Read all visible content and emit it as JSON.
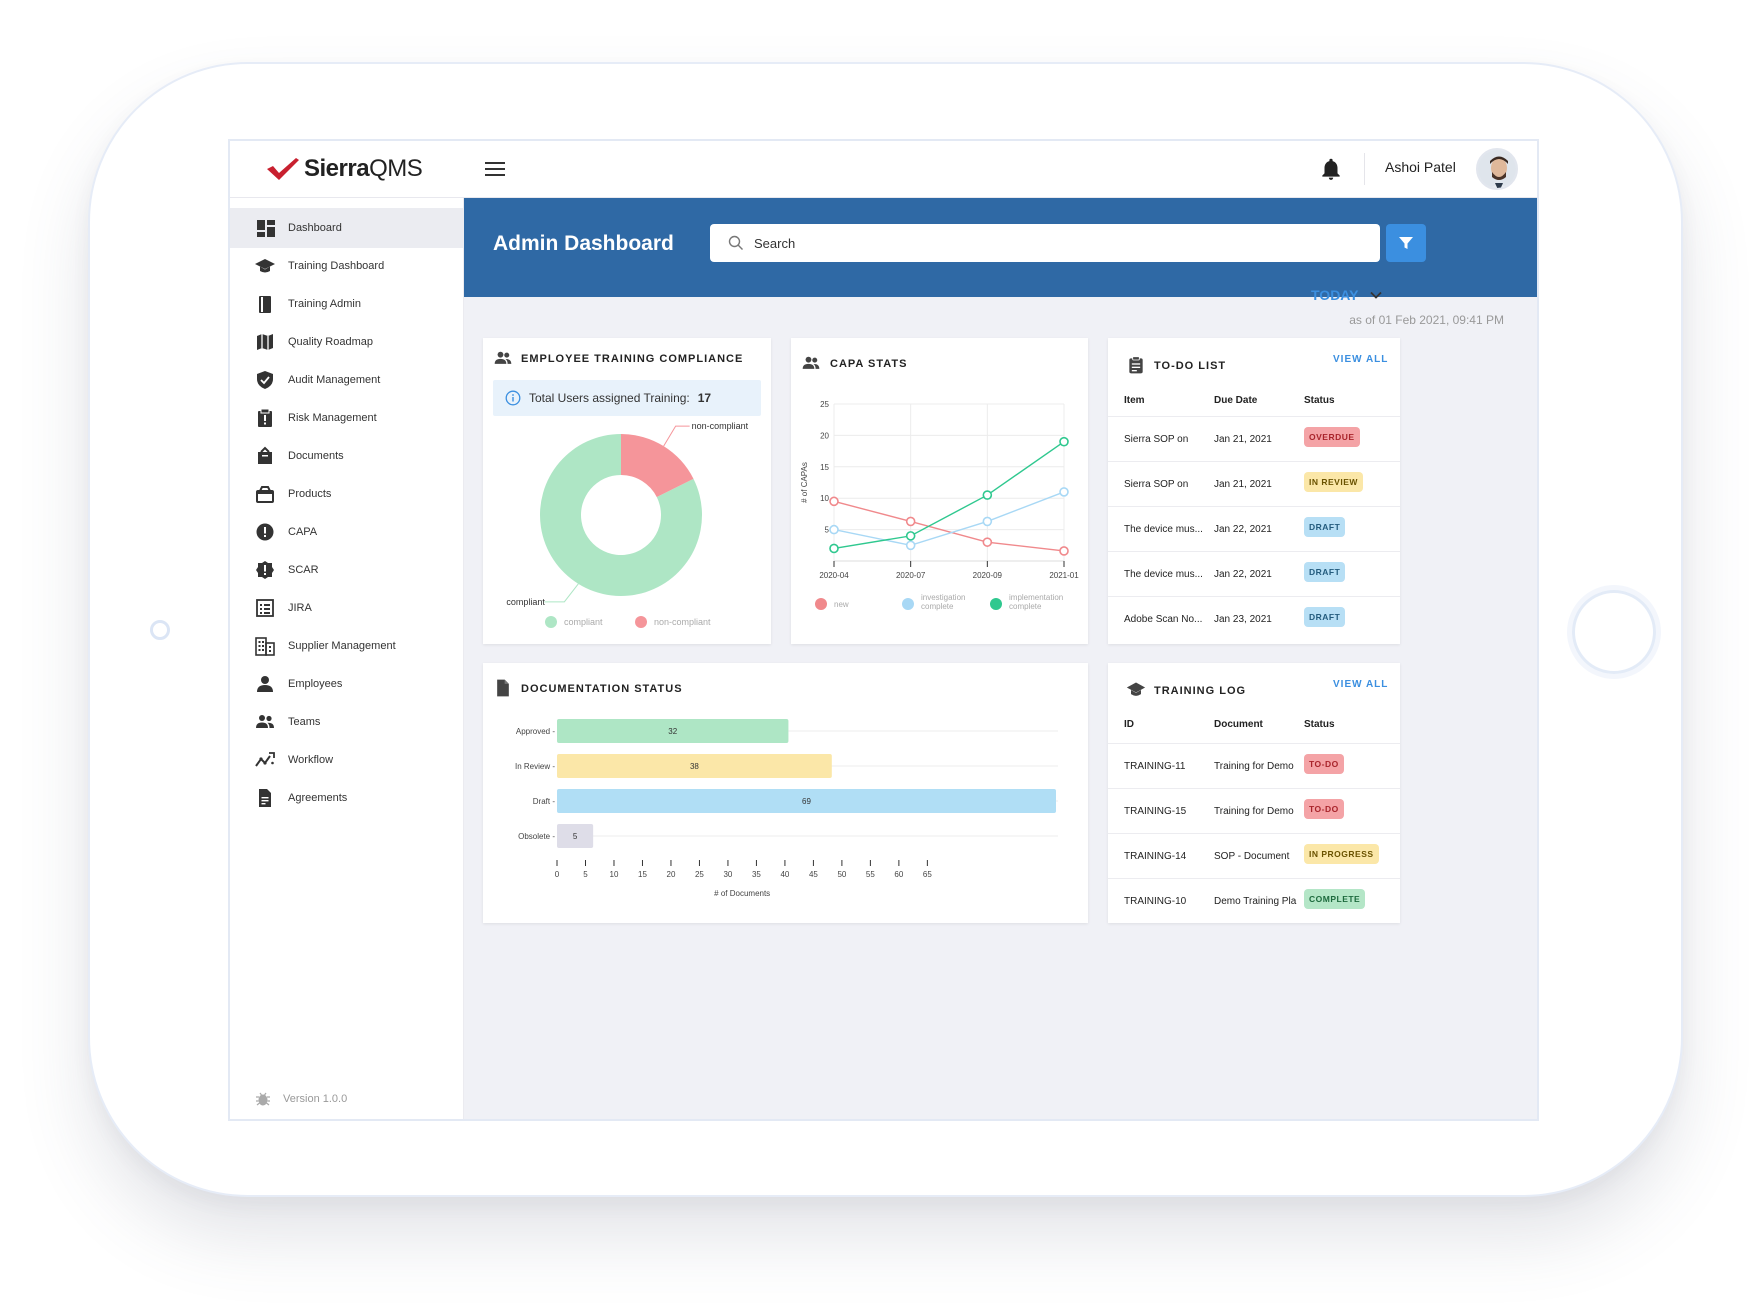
{
  "app": {
    "logo_text": "Sierra",
    "logo_text_bold": "",
    "logo_suffix": "QMS",
    "user_name": "Ashoi Patel"
  },
  "sidebar": {
    "items": [
      {
        "label": "Dashboard",
        "icon": "dashboard-icon",
        "active": true
      },
      {
        "label": "Training Dashboard",
        "icon": "graduation-cap-icon"
      },
      {
        "label": "Training Admin",
        "icon": "book-icon"
      },
      {
        "label": "Quality Roadmap",
        "icon": "map-icon"
      },
      {
        "label": "Audit Management",
        "icon": "shield-check-icon"
      },
      {
        "label": "Risk Management",
        "icon": "clipboard-alert-icon"
      },
      {
        "label": "Documents",
        "icon": "documents-icon"
      },
      {
        "label": "Products",
        "icon": "products-icon"
      },
      {
        "label": "CAPA",
        "icon": "alert-circle-icon"
      },
      {
        "label": "SCAR",
        "icon": "alert-badge-icon"
      },
      {
        "label": "JIRA",
        "icon": "list-icon"
      },
      {
        "label": "Supplier Management",
        "icon": "building-icon"
      },
      {
        "label": "Employees",
        "icon": "person-icon"
      },
      {
        "label": "Teams",
        "icon": "people-icon"
      },
      {
        "label": "Workflow",
        "icon": "workflow-icon"
      },
      {
        "label": "Agreements",
        "icon": "agreement-icon"
      }
    ],
    "version": "Version  1.0.0"
  },
  "header": {
    "title": "Admin Dashboard",
    "search_placeholder": "Search",
    "search_value": ""
  },
  "period": {
    "label": "TODAY",
    "as_of": "as of 01 Feb 2021, 09:41 PM"
  },
  "training_compliance": {
    "title": "EMPLOYEE TRAINING COMPLIANCE",
    "total_label": "Total Users assigned Training:",
    "total_value": "17"
  },
  "capa": {
    "title": "CAPA STATS"
  },
  "todo": {
    "title": "TO-DO LIST",
    "view_all": "VIEW ALL",
    "headers": [
      "Item",
      "Due Date",
      "Status"
    ],
    "rows": [
      {
        "item": "Sierra SOP on",
        "date": "Jan 21, 2021",
        "status": "OVERDUE",
        "kind": "red"
      },
      {
        "item": "Sierra SOP on",
        "date": "Jan 21, 2021",
        "status": "IN REVIEW",
        "kind": "yellow"
      },
      {
        "item": "The device mus...",
        "date": "Jan 22, 2021",
        "status": "DRAFT",
        "kind": "blue"
      },
      {
        "item": "The device mus...",
        "date": "Jan 22, 2021",
        "status": "DRAFT",
        "kind": "blue"
      },
      {
        "item": "Adobe Scan No...",
        "date": "Jan 23, 2021",
        "status": "DRAFT",
        "kind": "blue"
      }
    ]
  },
  "documentation": {
    "title": "DOCUMENTATION STATUS"
  },
  "training_log": {
    "title": "TRAINING LOG",
    "view_all": "VIEW ALL",
    "headers": [
      "ID",
      "Document",
      "Status"
    ],
    "rows": [
      {
        "id": "TRAINING-11",
        "doc": "Training for Demo",
        "status": "TO-DO",
        "kind": "red"
      },
      {
        "id": "TRAINING-15",
        "doc": "Training for Demo",
        "status": "TO-DO",
        "kind": "red"
      },
      {
        "id": "TRAINING-14",
        "doc": "SOP -  Document",
        "status": "IN PROGRESS",
        "kind": "yellow"
      },
      {
        "id": "TRAINING-10",
        "doc": "Demo Training Pla",
        "status": "COMPLETE",
        "kind": "green"
      }
    ]
  },
  "badge_colors": {
    "red": {
      "bg": "#f4a3a6",
      "fg": "#a8242b"
    },
    "yellow": {
      "bg": "#fbe7a8",
      "fg": "#6a5200"
    },
    "blue": {
      "bg": "#b7dff5",
      "fg": "#235b7d"
    },
    "green": {
      "bg": "#b4e6c7",
      "fg": "#1d6a3d"
    }
  },
  "chart_data": [
    {
      "type": "pie",
      "donut": true,
      "categories": [
        "compliant",
        "non-compliant"
      ],
      "values": [
        14,
        3
      ],
      "colors": [
        "#aee6c5",
        "#f5959a"
      ],
      "legend": "bottom"
    },
    {
      "type": "line",
      "x": [
        "2020-04",
        "2020-07",
        "2020-09",
        "2021-01"
      ],
      "ylabel": "# of CAPAs",
      "ylim": [
        0,
        25
      ],
      "yticks": [
        5,
        10,
        15,
        20,
        25
      ],
      "grid": true,
      "legend": "bottom",
      "series": [
        {
          "name": "new",
          "values": [
            9.5,
            6.3,
            3,
            1.6
          ],
          "color": "#f0898c"
        },
        {
          "name": "investigation complete",
          "values": [
            5,
            2.5,
            6.3,
            11
          ],
          "color": "#a8d8f5"
        },
        {
          "name": "implementation complete",
          "values": [
            2,
            4,
            10.5,
            19
          ],
          "color": "#2fc88f"
        }
      ]
    },
    {
      "type": "bar",
      "orientation": "horizontal",
      "categories": [
        "Approved",
        "In Review",
        "Draft",
        "Obsolete"
      ],
      "values": [
        32,
        38,
        69,
        5
      ],
      "colors": [
        "#aee6c5",
        "#fbe7a8",
        "#b0def5",
        "#dedde8"
      ],
      "xlabel": "# of Documents",
      "xlim": [
        0,
        65
      ],
      "xticks": [
        0,
        5,
        10,
        15,
        20,
        25,
        30,
        35,
        40,
        45,
        50,
        55,
        60,
        65
      ]
    }
  ]
}
